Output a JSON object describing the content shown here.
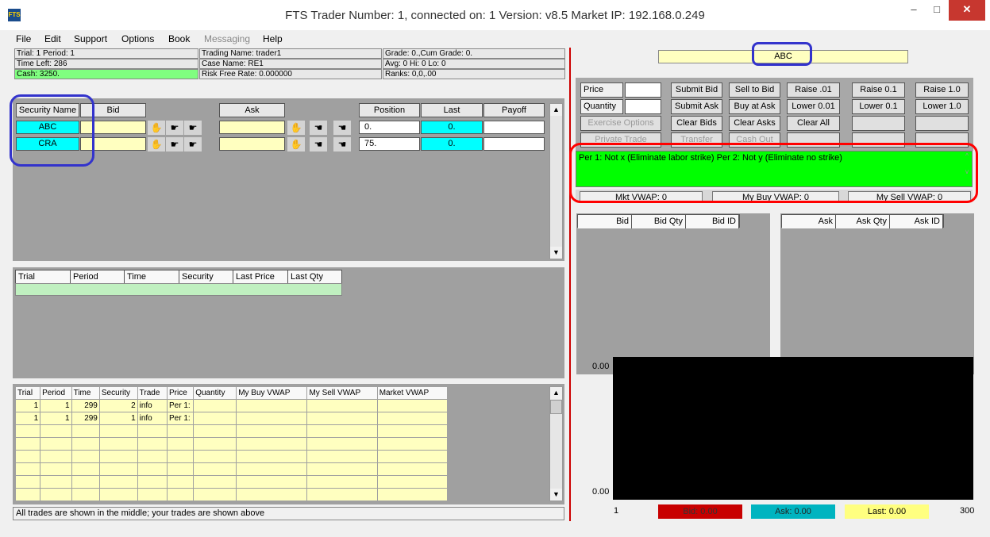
{
  "window": {
    "title": "FTS Trader Number: 1, connected on: 1 Version: v8.5 Market IP: 192.168.0.249",
    "icon": "FTS",
    "minimize": "–",
    "maximize": "□",
    "close": "✕"
  },
  "menu": [
    "File",
    "Edit",
    "Support",
    "Options",
    "Book",
    "Messaging",
    "Help"
  ],
  "info": {
    "trial_period": "Trial: 1 Period: 1",
    "trading_name": "Trading Name: trader1",
    "grade": "Grade: 0.,Cum Grade: 0.",
    "time_left": "Time Left: 286",
    "case_name": "Case Name: RE1",
    "avg": "Avg: 0 Hi: 0 Lo: 0",
    "cash": "Cash: 3250.",
    "risk_free": "Risk Free Rate: 0.000000",
    "ranks": "Ranks: 0,0,.00"
  },
  "securities": {
    "headers": {
      "name": "Security Name",
      "bid": "Bid",
      "ask": "Ask",
      "position": "Position",
      "last": "Last",
      "payoff": "Payoff"
    },
    "rows": [
      {
        "name": "ABC",
        "position": "0.",
        "last": "0."
      },
      {
        "name": "CRA",
        "position": "75.",
        "last": "0."
      }
    ]
  },
  "market_trades": {
    "headers": [
      "Trial",
      "Period",
      "Time",
      "Security",
      "Last Price",
      "Last Qty"
    ]
  },
  "my_trades": {
    "headers": [
      "Trial",
      "Period",
      "Time",
      "Security",
      "Trade",
      "Price",
      "Quantity",
      "My Buy VWAP",
      "My Sell VWAP",
      "Market VWAP"
    ],
    "rows": [
      [
        "1",
        "1",
        "299",
        "2",
        "info",
        "Per 1:",
        "",
        "",
        "",
        ""
      ],
      [
        "1",
        "1",
        "299",
        "1",
        "info",
        "Per 1:",
        "",
        "",
        "",
        ""
      ]
    ]
  },
  "status_text": "All trades are shown in the middle; your trades are shown above",
  "selected_security": "ABC",
  "order": {
    "price_label": "Price",
    "quantity_label": "Quantity",
    "buttons": {
      "submit_bid": "Submit Bid",
      "sell_to_bid": "Sell to Bid",
      "raise_001": "Raise .01",
      "raise_01": "Raise 0.1",
      "raise_10": "Raise 1.0",
      "submit_ask": "Submit Ask",
      "buy_at_ask": "Buy at Ask",
      "lower_001": "Lower 0.01",
      "lower_01": "Lower 0.1",
      "lower_10": "Lower 1.0",
      "exercise": "Exercise Options",
      "clear_bids": "Clear Bids",
      "clear_asks": "Clear Asks",
      "clear_all": "Clear All",
      "private_trade": "Private Trade",
      "transfer": "Transfer",
      "cash_out": "Cash Out"
    }
  },
  "news": "Per 1: Not x (Eliminate labor strike) Per 2: Not y (Eliminate no strike)",
  "vwap": {
    "mkt": "Mkt VWAP: 0",
    "my_buy": "My Buy VWAP: 0",
    "my_sell": "My Sell VWAP: 0"
  },
  "book": {
    "bid_headers": [
      "Bid",
      "Bid Qty",
      "Bid ID"
    ],
    "ask_headers": [
      "Ask",
      "Ask Qty",
      "Ask ID"
    ]
  },
  "price_chart": {
    "y_top": "0.00",
    "y_bottom": "0.00",
    "x_start": "1",
    "x_end": "300",
    "bid": "Bid: 0.00",
    "ask": "Ask: 0.00",
    "last": "Last: 0.00"
  },
  "colors": {
    "highlight_ring": "#3333cc",
    "news_ring": "#ff0000",
    "separator": "#cc0000",
    "cyan": "#00ffff",
    "green": "#00ff00",
    "bid_red": "#c80000",
    "ask_teal": "#00b4c0",
    "last_yellow": "#ffff80"
  }
}
